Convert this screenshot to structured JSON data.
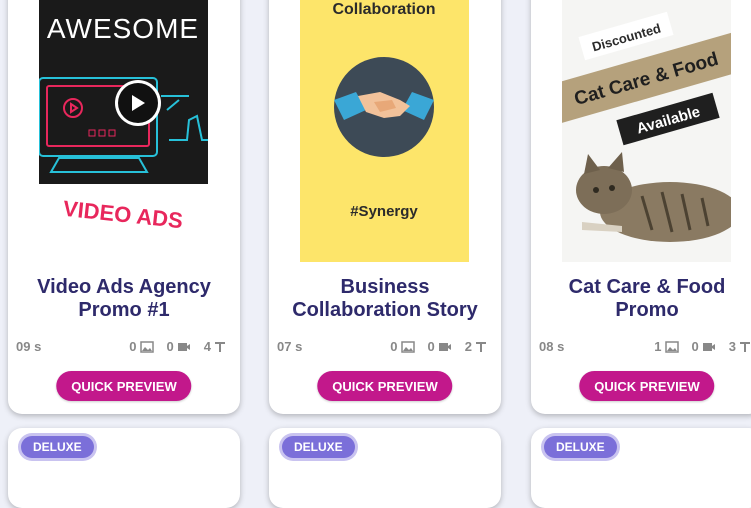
{
  "cards": [
    {
      "title": "Video Ads Agency Promo #1",
      "duration": "09 s",
      "images": "0",
      "videos": "0",
      "texts": "4",
      "button": "QUICK PREVIEW",
      "thumb_text_top": "AWESOME",
      "thumb_text_bottom": "VIDEO ADS"
    },
    {
      "title": "Business Collaboration Story",
      "duration": "07 s",
      "images": "0",
      "videos": "0",
      "texts": "2",
      "button": "QUICK PREVIEW",
      "thumb_text_top": "Collaboration",
      "thumb_text_bottom": "#Synergy"
    },
    {
      "title": "Cat Care & Food Promo",
      "duration": "08 s",
      "images": "1",
      "videos": "0",
      "texts": "3",
      "button": "QUICK PREVIEW",
      "thumb_text_top": "Discounted",
      "thumb_text_mid": "Cat Care & Food",
      "thumb_text_bottom": "Available"
    }
  ],
  "badges": [
    "DELUXE",
    "DELUXE",
    "DELUXE"
  ],
  "colors": {
    "title": "#2e2a6b",
    "button": "#c2188b",
    "badge": "#7b6fd9",
    "collab_bg": "#fde56a",
    "ads_bg": "#1a1a1a",
    "ads_accent": "#e8275c",
    "cat_band": "#b5a17c"
  }
}
